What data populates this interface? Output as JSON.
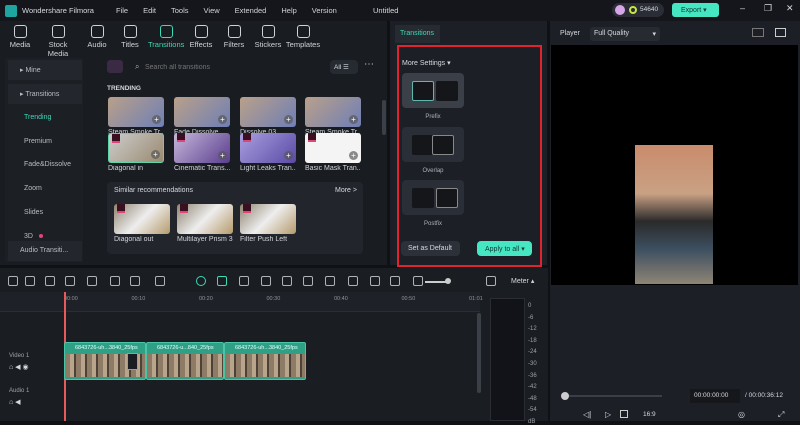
{
  "app": {
    "name": "Wondershare Filmora",
    "project": "Untitled",
    "credits": "54640",
    "export": "Export"
  },
  "menu": [
    "File",
    "Edit",
    "Tools",
    "View",
    "Extended",
    "Help",
    "Version"
  ],
  "toolbar": [
    {
      "label": "Media"
    },
    {
      "label": "Stock Media"
    },
    {
      "label": "Audio"
    },
    {
      "label": "Titles"
    },
    {
      "label": "Transitions",
      "active": true
    },
    {
      "label": "Effects"
    },
    {
      "label": "Filters"
    },
    {
      "label": "Stickers"
    },
    {
      "label": "Templates"
    }
  ],
  "sidebar": {
    "items": [
      {
        "label": "Mine"
      },
      {
        "label": "Transitions"
      },
      {
        "label": "Trending",
        "active": true
      },
      {
        "label": "Premium"
      },
      {
        "label": "Fade&Dissolve"
      },
      {
        "label": "Zoom"
      },
      {
        "label": "Slides"
      },
      {
        "label": "3D"
      },
      {
        "label": "Audio Transiti..."
      }
    ]
  },
  "browser": {
    "search_placeholder": "Search all transitions",
    "filter": "All",
    "section": "TRENDING",
    "row1": [
      "Steam Smoke Tr...",
      "Fade Dissolve",
      "Dissolve 03",
      "Steam Smoke Tr..."
    ],
    "row2": [
      "Diagonal in",
      "Cinematic Trans...",
      "Light Leaks Tran...",
      "Basic Mask Tran..."
    ],
    "similar_title": "Similar recommendations",
    "more": "More >",
    "similar": [
      "Diagonal out",
      "Multilayer Prism 3",
      "Filter Push Left"
    ]
  },
  "settings": {
    "tab": "Transitions",
    "more_settings": "More Settings",
    "options": [
      "Prefix",
      "Overlap",
      "Postfix"
    ],
    "set_default": "Set as Default",
    "apply_all": "Apply to all"
  },
  "player": {
    "label": "Player",
    "quality": "Full Quality",
    "current": "00:00:00:00",
    "total": "/ 00:00:36:12",
    "ratio": "16:9"
  },
  "timeline": {
    "meter": "Meter",
    "ruler": [
      "00:00",
      "00:10",
      "00:20",
      "00:30",
      "00:40",
      "00:50",
      "01:01"
    ],
    "tracks": [
      {
        "label": "Video 1"
      },
      {
        "label": "Audio 1"
      }
    ],
    "clips": [
      "6843726-uh...3840_25fps",
      "6843726-u...840_25fps",
      "6843726-uh...3840_25fps"
    ],
    "db_scale": [
      "0",
      "-6",
      "-12",
      "-18",
      "-24",
      "-30",
      "-36",
      "-42",
      "-48",
      "-54",
      "dB"
    ]
  },
  "colors": {
    "accent": "#3fd9b6",
    "export": "#47e6c3",
    "highlight": "#e0242f"
  }
}
